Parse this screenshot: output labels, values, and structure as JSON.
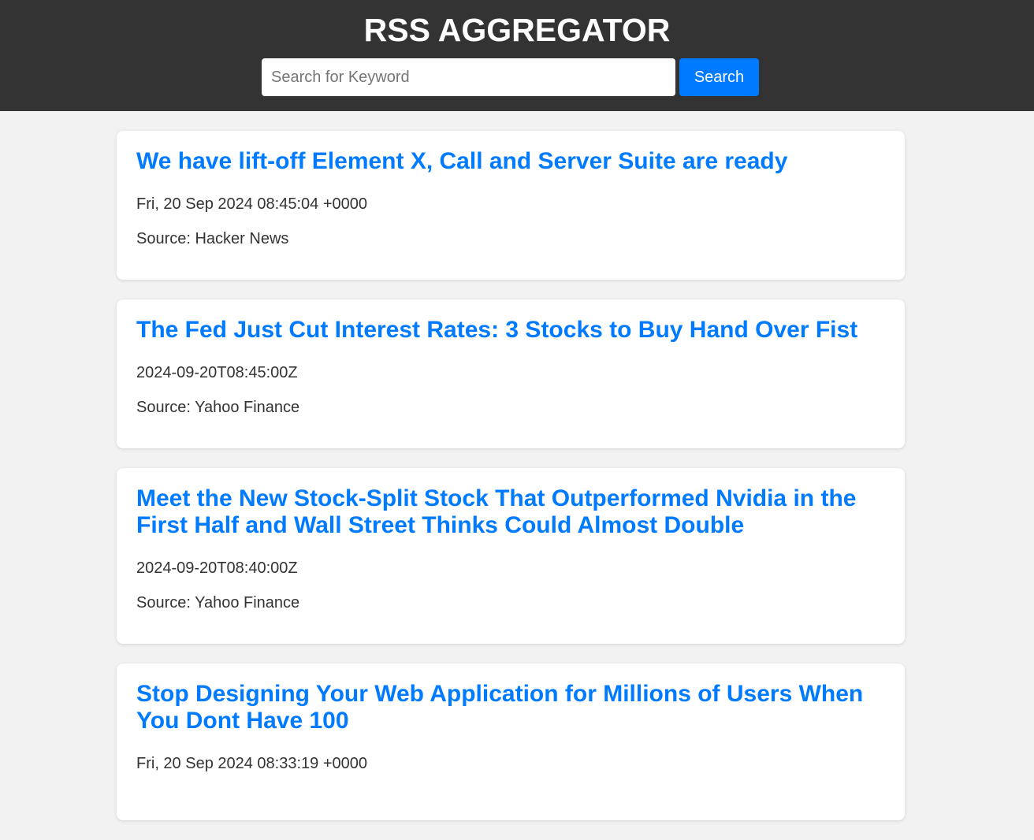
{
  "header": {
    "title": "RSS AGGREGATOR",
    "search_placeholder": "Search for Keyword",
    "search_value": "",
    "search_button_label": "Search"
  },
  "colors": {
    "header_bg": "#333333",
    "accent": "#007bff",
    "page_bg": "#f2f2f2",
    "card_bg": "#ffffff"
  },
  "articles": [
    {
      "title": "We have lift-off Element X, Call and Server Suite are ready",
      "date": "Fri, 20 Sep 2024 08:45:04 +0000",
      "source": "Source: Hacker News"
    },
    {
      "title": "The Fed Just Cut Interest Rates: 3 Stocks to Buy Hand Over Fist",
      "date": "2024-09-20T08:45:00Z",
      "source": "Source: Yahoo Finance"
    },
    {
      "title": "Meet the New Stock-Split Stock That Outperformed Nvidia in the First Half and Wall Street Thinks Could Almost Double",
      "date": "2024-09-20T08:40:00Z",
      "source": "Source: Yahoo Finance"
    },
    {
      "title": "Stop Designing Your Web Application for Millions of Users When You Dont Have 100",
      "date": "Fri, 20 Sep 2024 08:33:19 +0000",
      "source": ""
    }
  ]
}
